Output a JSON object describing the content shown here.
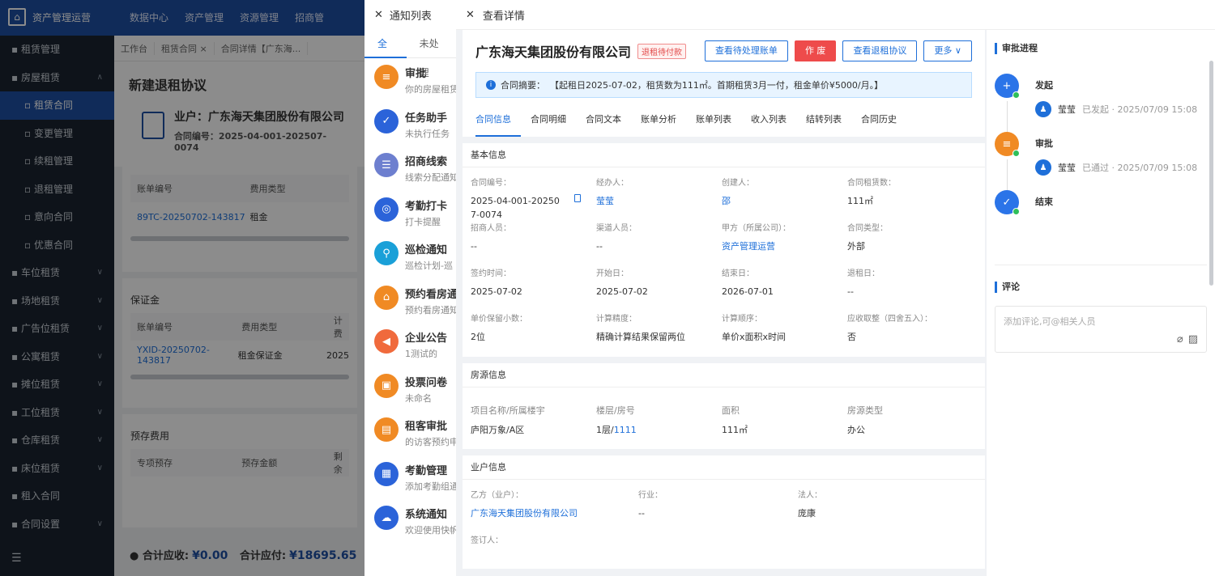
{
  "app": {
    "title": "资产管理运营",
    "topnav": [
      "数据中心",
      "资产管理",
      "资源管理",
      "招商管"
    ]
  },
  "sidebar": {
    "items": [
      {
        "label": "租赁管理",
        "level": 0,
        "chev": false
      },
      {
        "label": "房屋租赁",
        "level": 0,
        "chev": true
      },
      {
        "label": "租赁合同",
        "level": 1,
        "active": true
      },
      {
        "label": "变更管理",
        "level": 1
      },
      {
        "label": "续租管理",
        "level": 1
      },
      {
        "label": "退租管理",
        "level": 1
      },
      {
        "label": "意向合同",
        "level": 1
      },
      {
        "label": "优惠合同",
        "level": 1
      },
      {
        "label": "车位租赁",
        "level": 0,
        "chev": true
      },
      {
        "label": "场地租赁",
        "level": 0,
        "chev": true
      },
      {
        "label": "广告位租赁",
        "level": 0,
        "chev": true
      },
      {
        "label": "公寓租赁",
        "level": 0,
        "chev": true
      },
      {
        "label": "摊位租赁",
        "level": 0,
        "chev": true
      },
      {
        "label": "工位租赁",
        "level": 0,
        "chev": true
      },
      {
        "label": "仓库租赁",
        "level": 0,
        "chev": true
      },
      {
        "label": "床位租赁",
        "level": 0,
        "chev": true
      },
      {
        "label": "租入合同",
        "level": 0
      },
      {
        "label": "合同设置",
        "level": 0,
        "chev": true
      }
    ]
  },
  "main": {
    "tabs": [
      "工作台",
      "租赁合同 ×",
      "合同详情【广东海..."
    ],
    "page_title": "新建退租协议",
    "owner_title": "业户：广东海天集团股份有限公司",
    "contract_no": "合同编号：2025-04-001-202507-0074",
    "table1": {
      "headers": [
        "账单编号",
        "费用类型"
      ],
      "row": [
        "89TC-20250702-143817",
        "租金"
      ]
    },
    "deposit_title": "保证金",
    "table2": {
      "headers": [
        "账单编号",
        "费用类型",
        "计费"
      ],
      "row": [
        "YXID-20250702-143817",
        "租金保证金",
        "2025"
      ]
    },
    "prepaid_title": "预存费用",
    "table3": {
      "headers": [
        "专项预存",
        "预存金额",
        "剩余"
      ]
    },
    "total_recv_label": "合计应收:",
    "total_recv": "¥0.00",
    "total_pay_label": "合计应付:",
    "total_pay": "¥18695.65"
  },
  "notifications": {
    "title": "通知列表",
    "tabs": [
      "全部",
      "未处理"
    ],
    "items": [
      {
        "title": "审批",
        "sub": "你的房屋租赁",
        "color": "#f08a24",
        "icon": "≡"
      },
      {
        "title": "任务助手",
        "sub": "未执行任务",
        "color": "#2b63d9",
        "icon": "✓"
      },
      {
        "title": "招商线索",
        "sub": "线索分配通知",
        "color": "#6d7fcf",
        "icon": "☰"
      },
      {
        "title": "考勤打卡",
        "sub": "打卡提醒",
        "color": "#2b63d9",
        "icon": "◎"
      },
      {
        "title": "巡检通知",
        "sub": "巡检计划-巡",
        "color": "#1aa0d8",
        "icon": "⚲"
      },
      {
        "title": "预约看房通",
        "sub": "预约看房通知",
        "color": "#f08a24",
        "icon": "⌂"
      },
      {
        "title": "企业公告",
        "sub": "1测试的",
        "color": "#f06a3c",
        "icon": "◀"
      },
      {
        "title": "投票问卷",
        "sub": "未命名",
        "color": "#f08a24",
        "icon": "▣"
      },
      {
        "title": "租客审批",
        "sub": "的访客预约申",
        "color": "#f08a24",
        "icon": "▤"
      },
      {
        "title": "考勤管理",
        "sub": "添加考勤组通",
        "color": "#2b63d9",
        "icon": "▦"
      },
      {
        "title": "系统通知",
        "sub": "欢迎使用快帆",
        "color": "#2b63d9",
        "icon": "☁"
      }
    ]
  },
  "drawer": {
    "title": "查看详情",
    "company": "广东海天集团股份有限公司",
    "status_tag": "退租待付款",
    "buttons": {
      "pending_bills": "查看待处理账单",
      "void": "作 废",
      "refund_agreement": "查看退租协议",
      "more": "更多 ∨"
    },
    "summary_label": "合同摘要：",
    "summary_text": "【起租日2025-07-02，租赁数为111㎡。首期租赁3月一付，租金单价¥5000/月。】",
    "tabs": [
      "合同信息",
      "合同明细",
      "合同文本",
      "账单分析",
      "账单列表",
      "收入列表",
      "结转列表",
      "合同历史"
    ],
    "basic": {
      "title": "基本信息",
      "fields": [
        {
          "label": "合同编号：",
          "value": "2025-04-001-202507-0074",
          "copy": true
        },
        {
          "label": "经办人：",
          "value": "莹莹",
          "link": true
        },
        {
          "label": "创建人：",
          "value": "邵",
          "link": true
        },
        {
          "label": "合同租赁数：",
          "value": "111㎡"
        },
        {
          "label": "招商人员：",
          "value": "--"
        },
        {
          "label": "渠道人员：",
          "value": "--"
        },
        {
          "label": "甲方（所属公司）：",
          "value": "资产管理运营",
          "link": true
        },
        {
          "label": "合同类型：",
          "value": "外部"
        },
        {
          "label": "签约时间：",
          "value": "2025-07-02"
        },
        {
          "label": "开始日：",
          "value": "2025-07-02"
        },
        {
          "label": "结束日：",
          "value": "2026-07-01"
        },
        {
          "label": "退租日：",
          "value": "--"
        },
        {
          "label": "单价保留小数：",
          "value": "2位"
        },
        {
          "label": "计算精度：",
          "value": "精确计算结果保留两位"
        },
        {
          "label": "计算顺序：",
          "value": "单价x面积x时间"
        },
        {
          "label": "应收取整（四舍五入）：",
          "value": "否"
        }
      ]
    },
    "house": {
      "title": "房源信息",
      "headers": [
        "项目名称/所属楼宇",
        "楼层/房号",
        "面积",
        "房源类型"
      ],
      "row": [
        "庐阳万象/A区",
        "1层/",
        "1111",
        "111㎡",
        "办公"
      ]
    },
    "tenant": {
      "title": "业户信息",
      "fields": [
        {
          "label": "乙方（业户）：",
          "value": "广东海天集团股份有限公司",
          "link": true
        },
        {
          "label": "行业：",
          "value": "--"
        },
        {
          "label": "法人：",
          "value": "庞康"
        }
      ],
      "signer_label": "签订人："
    },
    "approval": {
      "title": "审批进程",
      "steps": [
        {
          "name": "发起",
          "user": "莹莹",
          "meta": "已发起 · 2025/07/09 15:08",
          "color": "#2b74e8",
          "icon": "+"
        },
        {
          "name": "审批",
          "user": "莹莹",
          "meta": "已通过 · 2025/07/09 15:08",
          "color": "#f08a24",
          "icon": "≡"
        },
        {
          "name": "结束",
          "color": "#2b74e8",
          "icon": "✓"
        }
      ]
    },
    "comments": {
      "title": "评论",
      "placeholder": "添加评论,可@相关人员"
    }
  }
}
